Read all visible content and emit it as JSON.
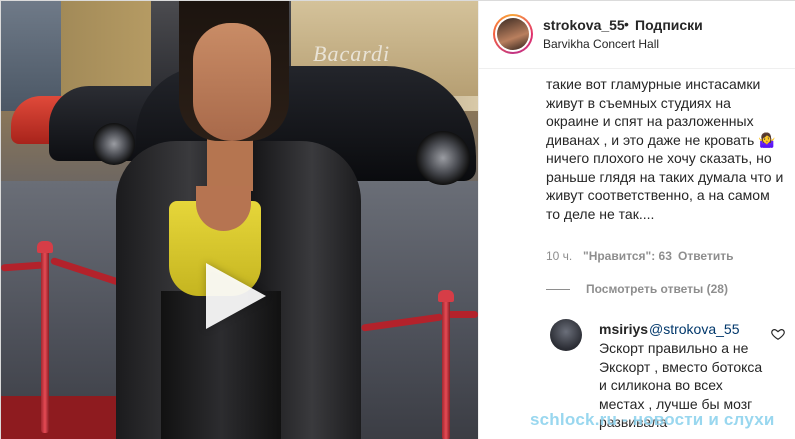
{
  "header": {
    "username": "strokova_55",
    "separator": "•",
    "follow_label": "Подписки",
    "location": "Barvikha Concert Hall"
  },
  "media": {
    "sign_text": "Bacardi",
    "play_icon": "play-icon"
  },
  "caption": {
    "text": "такие вот гламурные инстасамки живут в съемных студиях на окраине и спят на разложенных диванах , и это даже не кровать 🤷‍♀️ ничего плохого не хочу сказать, но раньше глядя на таких думала что и живут соответственно, а на самом то деле не так...."
  },
  "comment_meta": {
    "time": "10 ч.",
    "likes": "\"Нравится\": 63",
    "reply": "Ответить"
  },
  "replies": {
    "view_label": "Посмотреть ответы (28)"
  },
  "reply_comment": {
    "username": "msiriys",
    "mention": "@strokova_55",
    "text": "Эскорт правильно а не Экскорт , вместо ботокса и силикона во всех местах , лучше бы мозг развивала"
  },
  "watermark": {
    "text": "schlock.ru - новости и слухи"
  }
}
